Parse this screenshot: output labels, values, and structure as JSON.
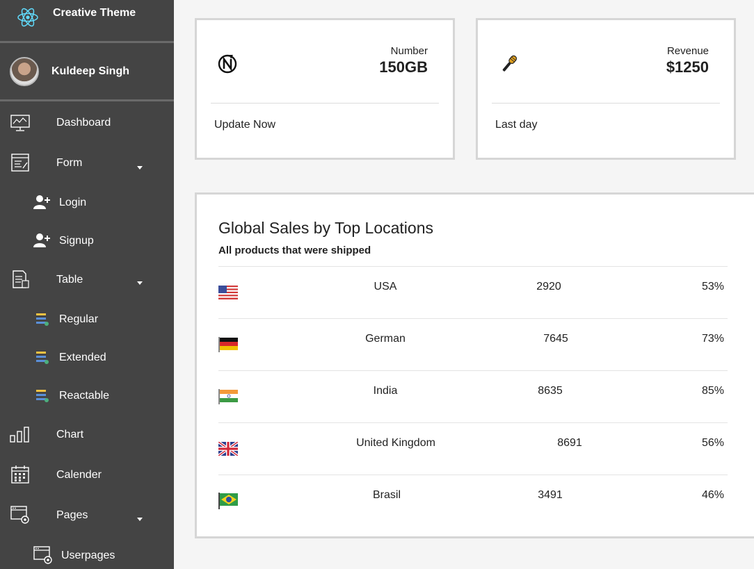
{
  "brand": {
    "name": "Creative Theme",
    "logo_icon": "react-atom-icon"
  },
  "user": {
    "name": "Kuldeep Singh"
  },
  "sidebar": {
    "items": [
      {
        "label": "Dashboard",
        "icon": "monitor-dashboard-icon"
      },
      {
        "label": "Form",
        "icon": "form-document-icon",
        "expandable": true
      },
      {
        "label": "Login",
        "icon": "user-plus-icon"
      },
      {
        "label": "Signup",
        "icon": "user-plus-icon"
      },
      {
        "label": "Table",
        "icon": "table-document-icon",
        "expandable": true
      },
      {
        "label": "Regular",
        "icon": "table-stripes-icon"
      },
      {
        "label": "Extended",
        "icon": "table-stripes-icon"
      },
      {
        "label": "Reactable",
        "icon": "table-stripes-icon"
      },
      {
        "label": "Chart",
        "icon": "bar-chart-icon"
      },
      {
        "label": "Calender",
        "icon": "calendar-icon"
      },
      {
        "label": "Pages",
        "icon": "pages-gear-icon",
        "expandable": true
      },
      {
        "label": "Userpages",
        "icon": "pages-gear-icon"
      }
    ]
  },
  "cards": [
    {
      "caption": "Number",
      "value": "150GB",
      "footer": "Update Now",
      "icon": "flash-n-icon"
    },
    {
      "caption": "Revenue",
      "value": "$1250",
      "footer": "Last day",
      "icon": "microphone-icon"
    }
  ],
  "sales": {
    "title": "Global Sales by Top Locations",
    "subtitle": "All products that were shipped",
    "rows": [
      {
        "flag": "usa-flag-icon",
        "country": "USA",
        "sales": "2920",
        "percent": "53%"
      },
      {
        "flag": "germany-flag-icon",
        "country": "German",
        "sales": "7645",
        "percent": "73%"
      },
      {
        "flag": "india-flag-icon",
        "country": "India",
        "sales": "8635",
        "percent": "85%"
      },
      {
        "flag": "uk-flag-icon",
        "country": "United Kingdom",
        "sales": "8691",
        "percent": "56%"
      },
      {
        "flag": "brazil-flag-icon",
        "country": "Brasil",
        "sales": "3491",
        "percent": "46%"
      }
    ]
  },
  "colors": {
    "sidebar_bg": "#444444",
    "page_bg": "#f5f5f5",
    "react_blue": "#61dafb"
  }
}
